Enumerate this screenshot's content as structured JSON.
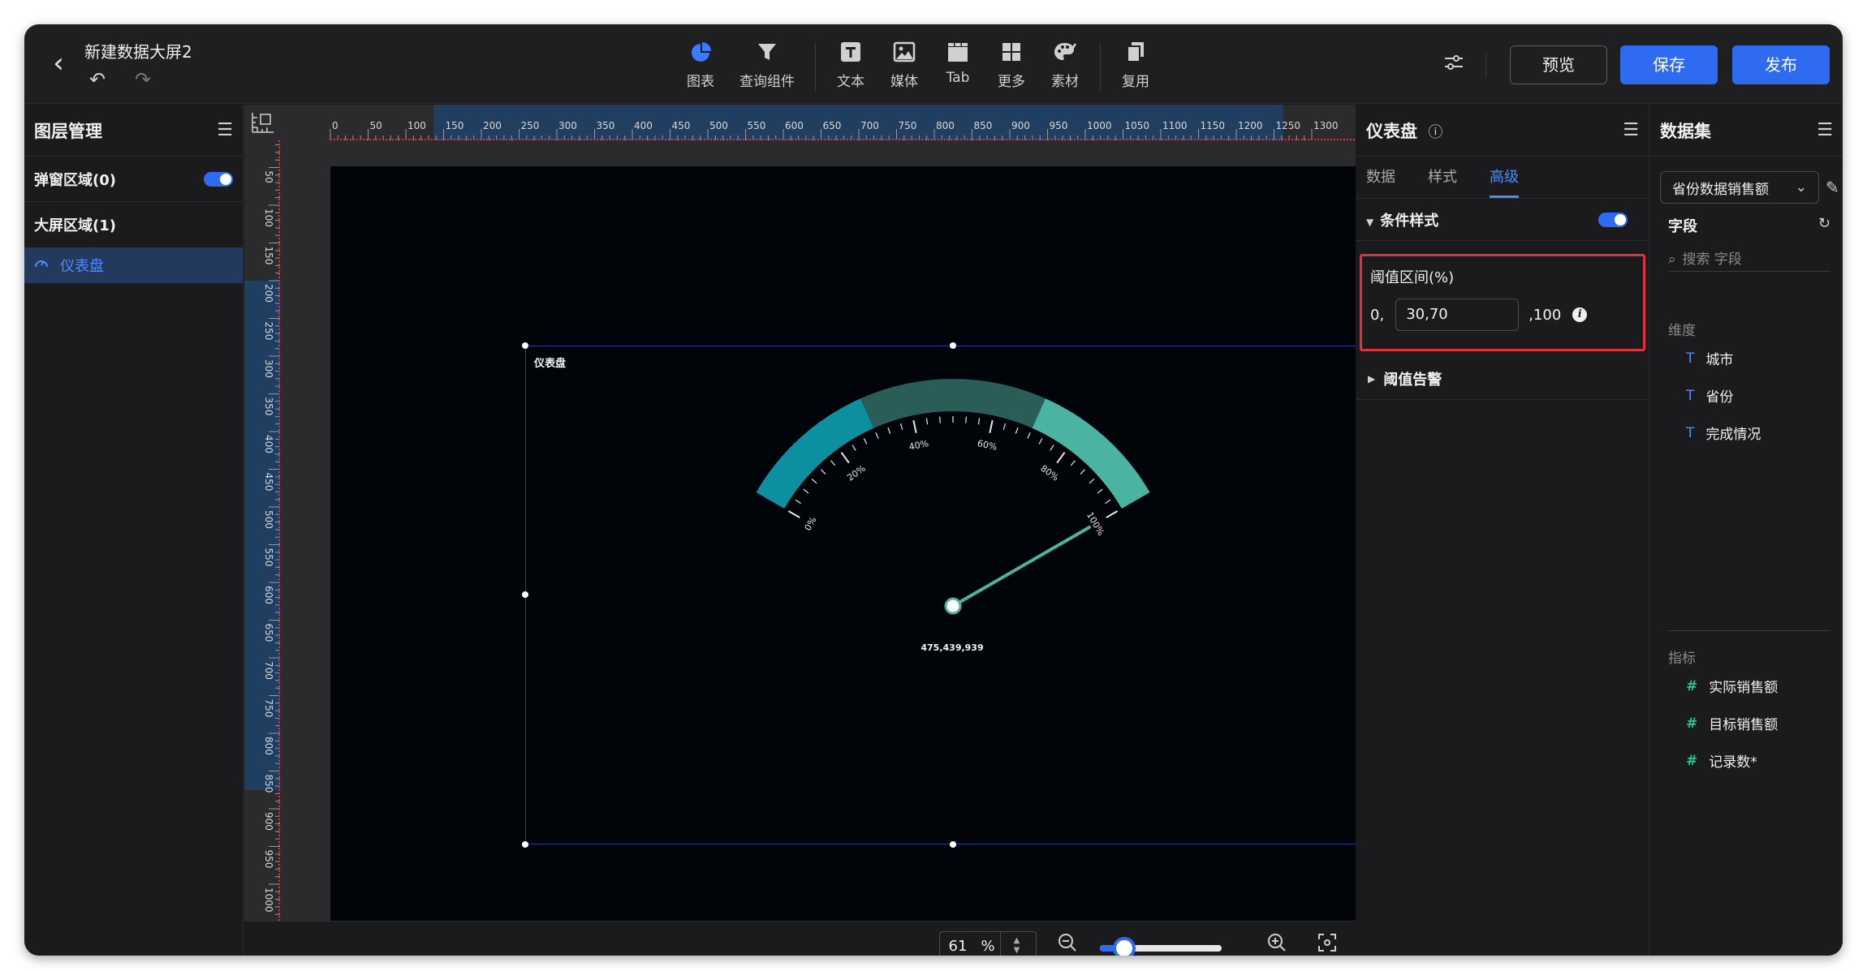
{
  "header": {
    "title": "新建数据大屏2",
    "toolbar": [
      {
        "label": "图表",
        "icon": "pie-chart-icon",
        "active": true
      },
      {
        "label": "查询组件",
        "icon": "filter-icon"
      },
      {
        "label": "文本",
        "icon": "text-icon"
      },
      {
        "label": "媒体",
        "icon": "image-icon"
      },
      {
        "label": "Tab",
        "icon": "tab-icon"
      },
      {
        "label": "更多",
        "icon": "grid-icon"
      },
      {
        "label": "素材",
        "icon": "palette-icon"
      },
      {
        "label": "复用",
        "icon": "copy-icon"
      }
    ],
    "preview_label": "预览",
    "save_label": "保存",
    "publish_label": "发布"
  },
  "layers": {
    "title": "图层管理",
    "popup_region": "弹窗区域(0)",
    "screen_region": "大屏区域(1)",
    "items": [
      {
        "label": "仪表盘",
        "icon": "gauge-icon"
      }
    ]
  },
  "canvas": {
    "h_ruler_ticks": [
      "0",
      "50",
      "100",
      "150",
      "200",
      "250",
      "300",
      "350",
      "400",
      "450",
      "500",
      "550",
      "600",
      "650",
      "700",
      "750",
      "800",
      "850",
      "900",
      "950",
      "1000",
      "1050",
      "1100",
      "1150",
      "1200",
      "1250",
      "1300"
    ],
    "v_ruler_ticks": [
      "50",
      "100",
      "150",
      "200",
      "250",
      "300",
      "350",
      "400",
      "450",
      "500",
      "550",
      "600",
      "650",
      "700",
      "750",
      "800",
      "850",
      "900",
      "950",
      "1000"
    ],
    "zoom_value": "61",
    "zoom_unit": "%",
    "zoom_slider_fraction": 0.2
  },
  "gauge": {
    "title": "仪表盘",
    "value_text": "475,439,939",
    "min": 0,
    "max": 100,
    "pointer_percent": 100,
    "threshold_bands": [
      30,
      70
    ],
    "scale_labels": [
      "0%",
      "20%",
      "40%",
      "60%",
      "80%",
      "100%"
    ],
    "colors": {
      "band_low": "#0c8f9e",
      "band_mid": "#2a5d57",
      "band_high": "#4ab3a1"
    }
  },
  "properties": {
    "title": "仪表盘",
    "tabs": [
      {
        "label": "数据"
      },
      {
        "label": "样式"
      },
      {
        "label": "高级",
        "active": true
      }
    ],
    "condition_style": "条件样式",
    "threshold_label": "阈值区间(%)",
    "threshold_prefix": "0,",
    "threshold_value": "30,70",
    "threshold_suffix": ",100",
    "threshold_alarm": "阈值告警"
  },
  "dataset": {
    "title": "数据集",
    "selected": "省份数据销售额",
    "fields_title": "字段",
    "search_placeholder": "搜索 字段",
    "dimension_label": "维度",
    "dimensions": [
      "城市",
      "省份",
      "完成情况"
    ],
    "measure_label": "指标",
    "measures": [
      "实际销售额",
      "目标销售额",
      "记录数*"
    ]
  }
}
